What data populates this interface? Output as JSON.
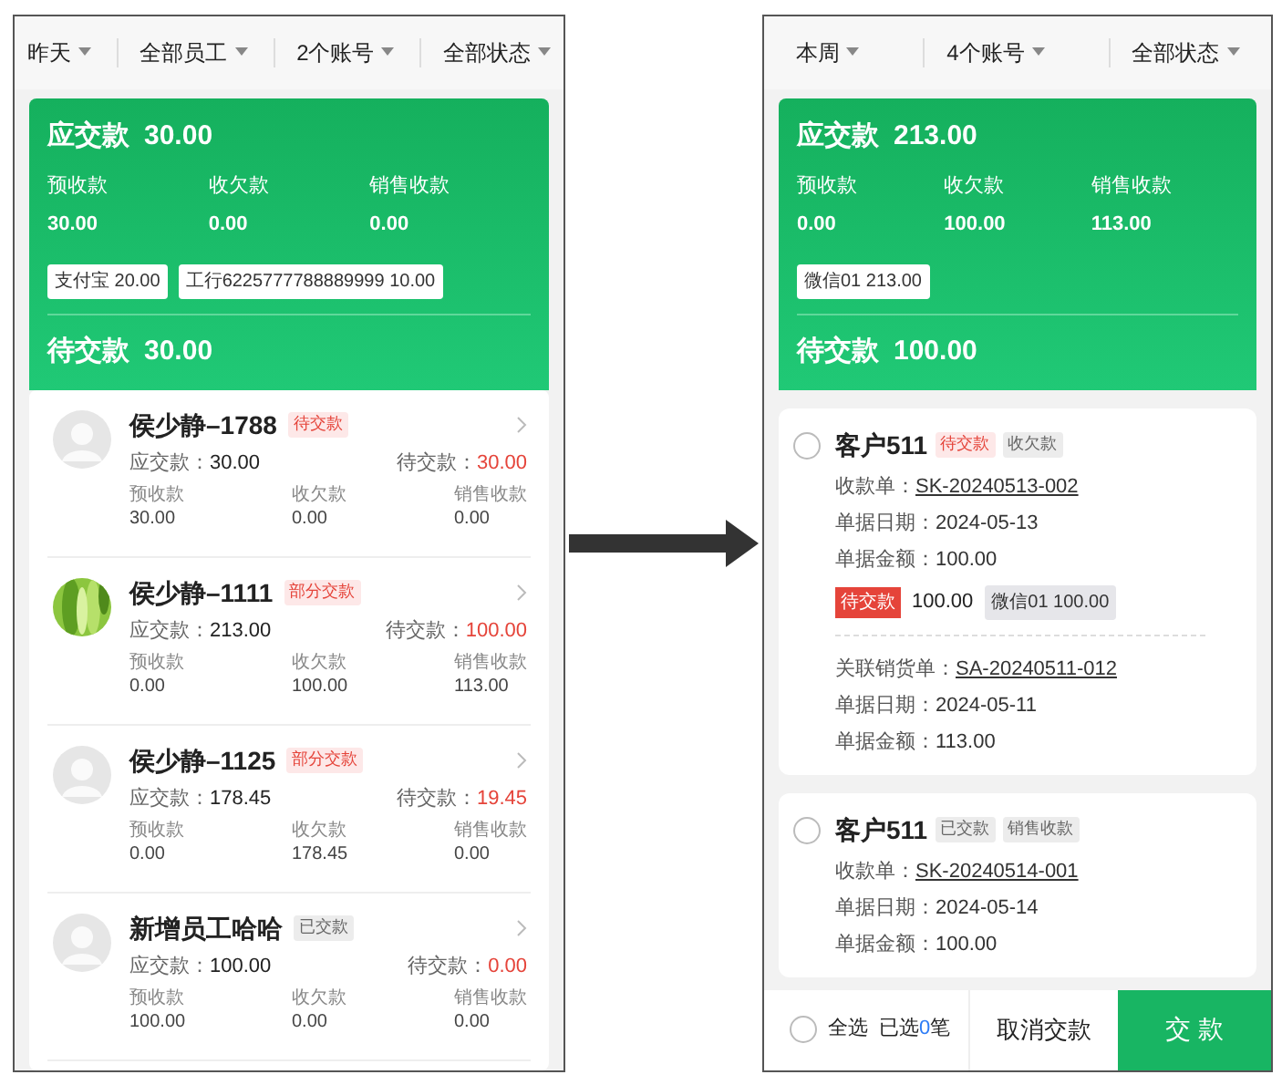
{
  "left": {
    "filters": [
      {
        "label": "昨天"
      },
      {
        "label": "全部员工"
      },
      {
        "label": "2个账号"
      },
      {
        "label": "全部状态"
      }
    ],
    "summary": {
      "title": "应交款",
      "amount": "30.00",
      "stats": [
        {
          "label": "预收款",
          "value": "30.00"
        },
        {
          "label": "收欠款",
          "value": "0.00"
        },
        {
          "label": "销售收款",
          "value": "0.00"
        }
      ],
      "accounts": [
        "支付宝 20.00",
        "工行6225777788889999 10.00"
      ],
      "pending_label": "待交款",
      "pending_amount": "30.00"
    },
    "employees": [
      {
        "name": "侯少静–1788",
        "kind": "default",
        "status": {
          "text": "待交款",
          "kind": "red"
        },
        "due_label": "应交款：",
        "due": "30.00",
        "pending_label": "待交款：",
        "pending": "30.00",
        "stats": [
          {
            "label": "预收款",
            "value": "30.00"
          },
          {
            "label": "收欠款",
            "value": "0.00"
          },
          {
            "label": "销售收款",
            "value": "0.00"
          }
        ]
      },
      {
        "name": "侯少静–1111",
        "kind": "picture",
        "status": {
          "text": "部分交款",
          "kind": "red"
        },
        "due_label": "应交款：",
        "due": "213.00",
        "pending_label": "待交款：",
        "pending": "100.00",
        "stats": [
          {
            "label": "预收款",
            "value": "0.00"
          },
          {
            "label": "收欠款",
            "value": "100.00"
          },
          {
            "label": "销售收款",
            "value": "113.00"
          }
        ]
      },
      {
        "name": "侯少静–1125",
        "kind": "default",
        "status": {
          "text": "部分交款",
          "kind": "red"
        },
        "due_label": "应交款：",
        "due": "178.45",
        "pending_label": "待交款：",
        "pending": "19.45",
        "stats": [
          {
            "label": "预收款",
            "value": "0.00"
          },
          {
            "label": "收欠款",
            "value": "178.45"
          },
          {
            "label": "销售收款",
            "value": "0.00"
          }
        ]
      },
      {
        "name": "新增员工哈哈",
        "kind": "default",
        "status": {
          "text": "已交款",
          "kind": "gray"
        },
        "due_label": "应交款：",
        "due": "100.00",
        "pending_label": "待交款：",
        "pending": "0.00",
        "stats": [
          {
            "label": "预收款",
            "value": "100.00"
          },
          {
            "label": "收欠款",
            "value": "0.00"
          },
          {
            "label": "销售收款",
            "value": "0.00"
          }
        ]
      }
    ]
  },
  "right": {
    "filters": [
      {
        "label": "本周"
      },
      {
        "label": "4个账号"
      },
      {
        "label": "全部状态"
      }
    ],
    "summary": {
      "title": "应交款",
      "amount": "213.00",
      "stats": [
        {
          "label": "预收款",
          "value": "0.00"
        },
        {
          "label": "收欠款",
          "value": "100.00"
        },
        {
          "label": "销售收款",
          "value": "113.00"
        }
      ],
      "accounts": [
        "微信01 213.00"
      ],
      "pending_label": "待交款",
      "pending_amount": "100.00"
    },
    "orders": [
      {
        "customer": "客户511",
        "checked": false,
        "tags": [
          {
            "text": "待交款",
            "kind": "red"
          },
          {
            "text": "收欠款",
            "kind": "gray"
          }
        ],
        "lines": [
          {
            "label": "收款单：",
            "value": "SK-20240513-002",
            "link": true
          },
          {
            "label": "单据日期：",
            "value": "2024-05-13",
            "link": false
          },
          {
            "label": "单据金额：",
            "value": "100.00",
            "link": false
          }
        ],
        "badge": {
          "label": "待交款",
          "amount": "100.00"
        },
        "account": "微信01 100.00",
        "linked": [
          {
            "label": "关联销货单：",
            "value": "SA-20240511-012",
            "link": true
          },
          {
            "label": "单据日期：",
            "value": "2024-05-11",
            "link": false
          },
          {
            "label": "单据金额：",
            "value": "113.00",
            "link": false
          }
        ]
      },
      {
        "customer": "客户511",
        "checked": false,
        "tags": [
          {
            "text": "已交款",
            "kind": "gray"
          },
          {
            "text": "销售收款",
            "kind": "gray"
          }
        ],
        "lines": [
          {
            "label": "收款单：",
            "value": "SK-20240514-001",
            "link": true
          },
          {
            "label": "单据日期：",
            "value": "2024-05-14",
            "link": false
          },
          {
            "label": "单据金额：",
            "value": "100.00",
            "link": false
          }
        ]
      }
    ],
    "bottom_bar": {
      "select_all": {
        "label": "全选",
        "checked": false
      },
      "selected_prefix": "已选",
      "selected_count": "0",
      "selected_suffix": "笔",
      "cancel": "取消交款",
      "submit": "交 款"
    }
  }
}
